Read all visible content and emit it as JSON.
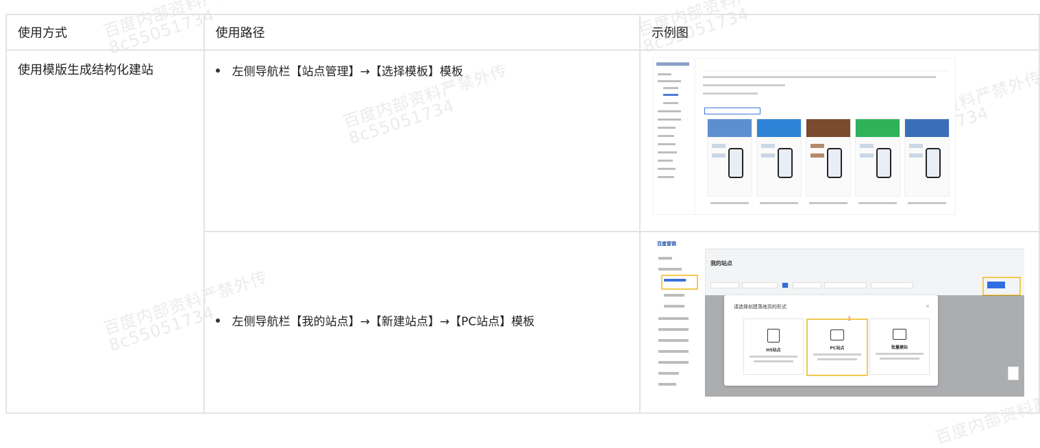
{
  "table": {
    "headers": [
      "使用方式",
      "使用路径",
      "示例图"
    ],
    "method": "使用模版生成结构化建站",
    "rows": [
      {
        "path": "左侧导航栏【站点管理】→【选择模板】模板"
      },
      {
        "path": "左侧导航栏【我的站点】→【新建站点】→【PC站点】模板"
      }
    ]
  },
  "watermark": {
    "line1": "百度内部资料严禁外传",
    "line2": "8c55051734"
  },
  "shot2": {
    "logo": "百度营销",
    "title": "我的站点",
    "modal_title": "请选择创建落地页的形式",
    "close": "×",
    "step_number": "3",
    "options": [
      {
        "label": "H5站点"
      },
      {
        "label": "PC站点"
      },
      {
        "label": "批量建站"
      }
    ]
  }
}
